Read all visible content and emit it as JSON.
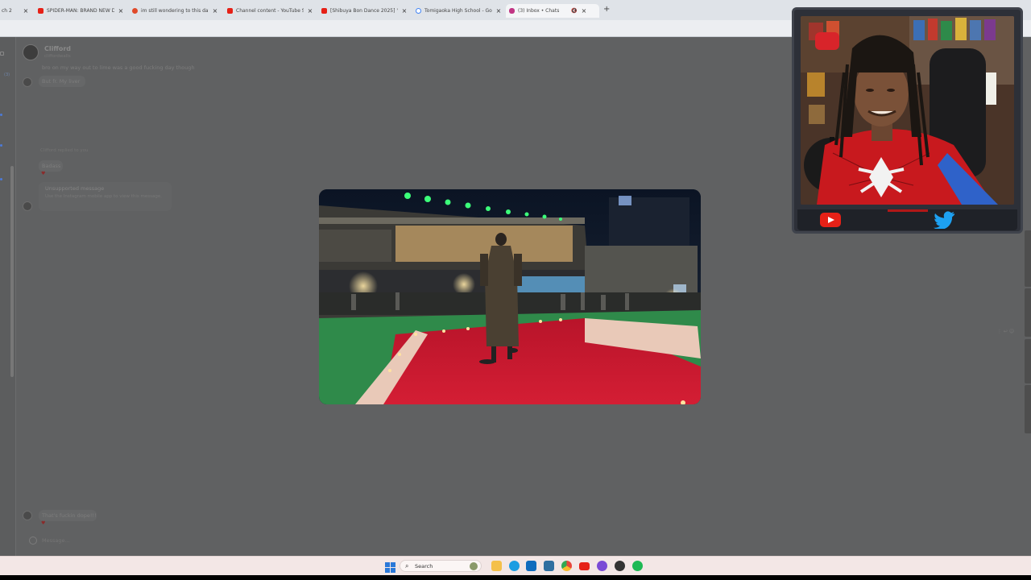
{
  "browser": {
    "tabs": [
      {
        "title": "ch 2",
        "favicon_color": "#8a8f98"
      },
      {
        "title": "SPIDER-MAN: BRAND NEW DA",
        "favicon_color": "#e62117"
      },
      {
        "title": "im still wondering to this day y",
        "favicon_color": "#e62117"
      },
      {
        "title": "Channel content - YouTube Stu",
        "favicon_color": "#e62117"
      },
      {
        "title": "[Shibuya Bon Dance 2025] \"D",
        "favicon_color": "#e62117"
      },
      {
        "title": "Tomigaoka High School - Goo",
        "favicon_color": "#4285f4"
      },
      {
        "title": "(3) Inbox • Chats",
        "favicon_color": "#c13584"
      }
    ],
    "close_glyph": "×",
    "newtab_glyph": "+",
    "mute_glyph": "🔇"
  },
  "chat": {
    "contact_name": "Clifford",
    "contact_handle": "cliffordwalls",
    "messages": [
      {
        "text": "bro on my way out to lime was a good fucking day though",
        "from": "them"
      },
      {
        "text": "But fr. My liver",
        "from": "them"
      },
      {
        "text": "Clifford replied to you",
        "from": "meta"
      },
      {
        "text": "Badass",
        "from": "me",
        "reaction": "♥"
      },
      {
        "text": "Unsupported message",
        "from": "them",
        "kind": "unsupported"
      },
      {
        "text": "Use the Instagram mobile app to view this message.",
        "from": "them",
        "kind": "unsupported-sub"
      },
      {
        "text": "That's fuckin dope!!!",
        "from": "them",
        "reaction": "♥"
      }
    ],
    "composer_placeholder": "Message..."
  },
  "taskbar": {
    "search_label": "Search",
    "search_glyph": "⌕",
    "icons": [
      {
        "name": "windows-start-icon",
        "color": "#2b79d8"
      },
      {
        "name": "copilot-icon",
        "color": "#8a8a8a"
      },
      {
        "name": "file-explorer-icon",
        "color": "#f4c04b"
      },
      {
        "name": "edge-icon",
        "color": "#1b9de2"
      },
      {
        "name": "outlook-icon",
        "color": "#0f6cbd"
      },
      {
        "name": "app-icon",
        "color": "#2f6fa0"
      },
      {
        "name": "chrome-icon",
        "color": "#e8453c"
      },
      {
        "name": "youtube-icon",
        "color": "#e62117"
      },
      {
        "name": "app-icon-2",
        "color": "#7a4bd6"
      },
      {
        "name": "app-icon-3",
        "color": "#333333"
      },
      {
        "name": "spotify-icon",
        "color": "#1db954"
      }
    ]
  },
  "webcam": {
    "social_icons": [
      "youtube-icon",
      "twitter-icon"
    ],
    "youtube_color": "#e62117",
    "twitter_color": "#1da1f2"
  }
}
